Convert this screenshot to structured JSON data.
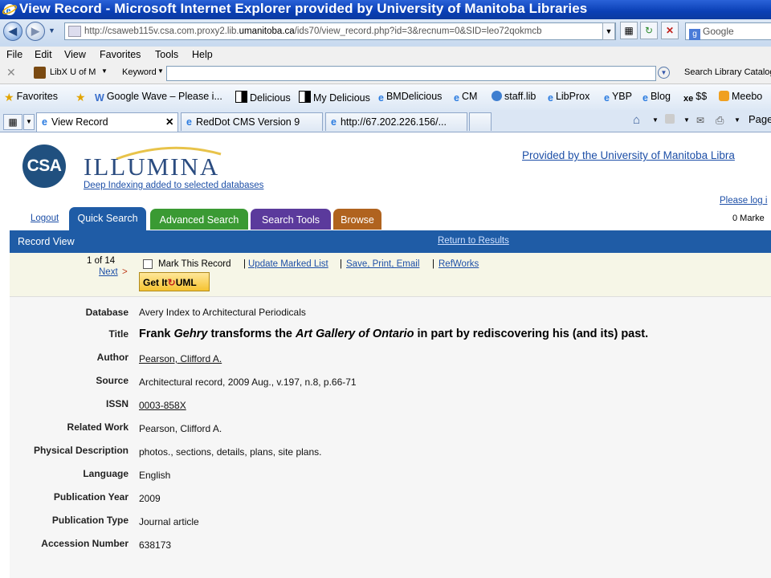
{
  "window": {
    "title": "View Record - Microsoft Internet Explorer provided by University of Manitoba Libraries"
  },
  "address_bar": {
    "url_prefix": "http://csaweb115v.csa.com.proxy2.lib.",
    "url_host": "umanitoba.ca",
    "url_suffix": "/ids70/view_record.php?id=3&recnum=0&SID=leo72qokmcb",
    "search_placeholder": "Google"
  },
  "menu": [
    "File",
    "Edit",
    "View",
    "Favorites",
    "Tools",
    "Help"
  ],
  "libx": {
    "name": "LibX U of M",
    "keyword_label": "Keyword",
    "search_catalog": "Search Library Catalog"
  },
  "favorites_bar": {
    "favorites_label": "Favorites",
    "items": [
      "Google Wave – Please i...",
      "Delicious",
      "My Delicious",
      "BMDelicious",
      "CM",
      "staff.lib",
      "LibProx",
      "YBP",
      "Blog",
      "$$",
      "Meebo"
    ]
  },
  "tabs": [
    {
      "label": "View Record"
    },
    {
      "label": "RedDot CMS Version 9"
    },
    {
      "label": "http://67.202.226.156/..."
    }
  ],
  "command_bar": {
    "page_label": "Page"
  },
  "header": {
    "logo_text": "CSA",
    "brand": "ILLUMINA",
    "deep_indexing": "Deep Indexing added to selected databases",
    "provided_by": "Provided by the University of Manitoba Libra",
    "please_log": "Please log i",
    "logout": "Logout",
    "marked": "0 Marke"
  },
  "nav_tabs": [
    {
      "label": "Quick Search",
      "color": "#1f5ca6"
    },
    {
      "label": "Advanced Search",
      "color": "#3a9a33"
    },
    {
      "label": "Search Tools",
      "color": "#5b3a9c"
    },
    {
      "label": "Browse",
      "color": "#b0631f"
    }
  ],
  "record_view": {
    "label": "Record View",
    "return": "Return to Results"
  },
  "actions": {
    "position": "1 of 14",
    "next": "Next",
    "next_arrow": ">",
    "mark": "Mark This Record",
    "update": "Update Marked List",
    "save": "Save, Print, Email",
    "refworks": "RefWorks",
    "getit_pre": "Get It",
    "getit_post": "UML",
    "sep": "|"
  },
  "record": {
    "database": {
      "label": "Database",
      "value": "Avery Index to Architectural Periodicals"
    },
    "title": {
      "label": "Title",
      "parts": [
        "Frank ",
        "Gehry",
        " transforms the ",
        "Art Gallery of Ontario",
        " in part by rediscovering his (and its) past."
      ]
    },
    "author": {
      "label": "Author",
      "value": "Pearson, Clifford A."
    },
    "source": {
      "label": "Source",
      "value": "Architectural record, 2009 Aug., v.197, n.8, p.66-71"
    },
    "issn": {
      "label": "ISSN",
      "value": "0003-858X"
    },
    "related_work": {
      "label": "Related Work",
      "value": "Pearson, Clifford A."
    },
    "physical_description": {
      "label": "Physical Description",
      "value": "photos., sections, details, plans, site plans."
    },
    "language": {
      "label": "Language",
      "value": "English"
    },
    "publication_year": {
      "label": "Publication Year",
      "value": "2009"
    },
    "publication_type": {
      "label": "Publication Type",
      "value": "Journal article"
    },
    "accession_number": {
      "label": "Accession Number",
      "value": "638173"
    }
  }
}
